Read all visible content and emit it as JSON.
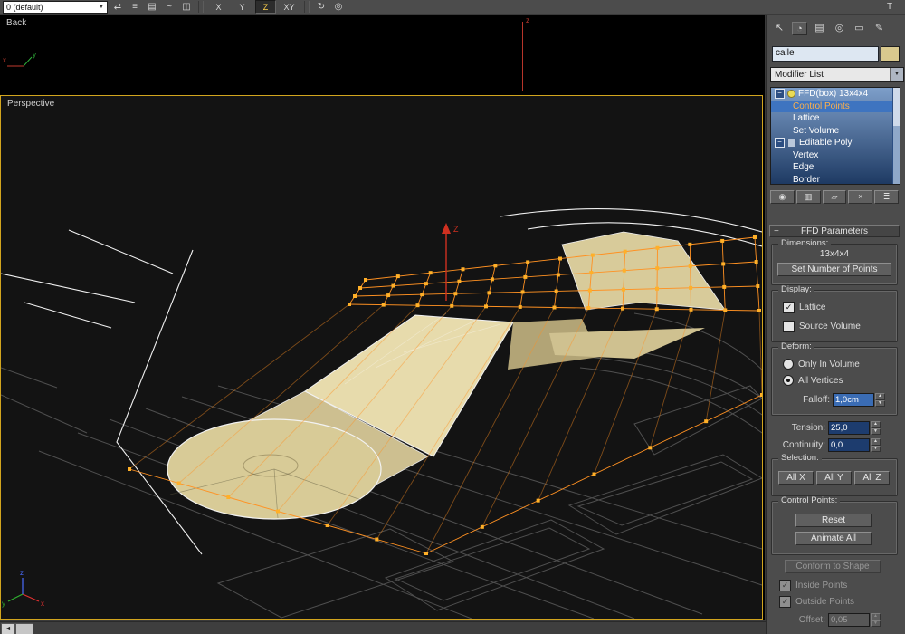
{
  "toolbar": {
    "selection_set_value": "0 (default)",
    "icons": [
      {
        "name": "mirror-icon",
        "glyph": "⇄"
      },
      {
        "name": "align-icon",
        "glyph": "≡"
      },
      {
        "name": "manage-layers-icon",
        "glyph": "▤"
      },
      {
        "name": "curve-editor-icon",
        "glyph": "~"
      },
      {
        "name": "schematic-view-icon",
        "glyph": "◫"
      }
    ],
    "axis_constraints": {
      "x": "X",
      "y": "Y",
      "z": "Z",
      "xy": "XY"
    },
    "active_axis": "Z",
    "right_icons": {
      "rotate": "↻",
      "snap": "◎",
      "teapot": "T"
    }
  },
  "viewports": {
    "back_label": "Back",
    "perspective_label": "Perspective",
    "z_axis_small": "z",
    "z_axis_label": "Z",
    "x_label": "x",
    "y_label": "y",
    "z_label": "z"
  },
  "scene": {
    "lattice_cols": 13,
    "lattice_rows": 4,
    "lattice_color": "#ff9122",
    "control_point_color": "#ffb028",
    "road_color": "#d8cb97",
    "active_viewport_border": "#d2a51e"
  },
  "command_panel": {
    "tabs": {
      "create": "↖",
      "modify": "◔",
      "hierarchy": "▤",
      "motion": "◎",
      "display": "▭",
      "utilities": "✎"
    },
    "object_name": "calle",
    "object_color": "#d9c98e",
    "modifier_list_label": "Modifier List",
    "stack": [
      {
        "label": "FFD(box) 13x4x4",
        "level": 0,
        "selected": false
      },
      {
        "label": "Control Points",
        "level": 1,
        "selected": true
      },
      {
        "label": "Lattice",
        "level": 1,
        "selected": false
      },
      {
        "label": "Set Volume",
        "level": 1,
        "selected": false
      },
      {
        "label": "Editable Poly",
        "level": 0,
        "selected": false
      },
      {
        "label": "Vertex",
        "level": 1,
        "selected": false
      },
      {
        "label": "Edge",
        "level": 1,
        "selected": false
      },
      {
        "label": "Border",
        "level": 1,
        "selected": false
      }
    ],
    "stack_buttons": {
      "pin": "◉",
      "show_end": "▥",
      "unique": "▱",
      "remove": "×",
      "configure": "≣"
    },
    "rollout_title": "FFD Parameters",
    "dimensions": {
      "title": "Dimensions:",
      "value": "13x4x4",
      "set_points_button": "Set Number of Points"
    },
    "display": {
      "title": "Display:",
      "lattice_label": "Lattice",
      "lattice_checked": true,
      "source_volume_label": "Source Volume",
      "source_volume_checked": false
    },
    "deform": {
      "title": "Deform:",
      "only_in_volume": "Only In Volume",
      "all_vertices": "All Vertices",
      "selected": "All Vertices",
      "falloff_label": "Falloff:",
      "falloff_value": "1,0cm"
    },
    "tension_label": "Tension:",
    "tension_value": "25,0",
    "continuity_label": "Continuity:",
    "continuity_value": "0,0",
    "selection": {
      "title": "Selection:",
      "all_x": "All X",
      "all_y": "All Y",
      "all_z": "All Z"
    },
    "control_points": {
      "title": "Control Points:",
      "reset_button": "Reset",
      "animate_all_button": "Animate All"
    },
    "conform_button": "Conform to Shape",
    "inside_points_label": "Inside Points",
    "inside_points_checked": true,
    "outside_points_label": "Outside Points",
    "outside_points_checked": true,
    "offset_label": "Offset:",
    "offset_value": "0,05"
  },
  "ui": {
    "spin_up": "▲",
    "spin_down": "▼",
    "check": "✓",
    "minus": "−",
    "dropdown_arrow": "▼",
    "scroll_left": "◄"
  }
}
